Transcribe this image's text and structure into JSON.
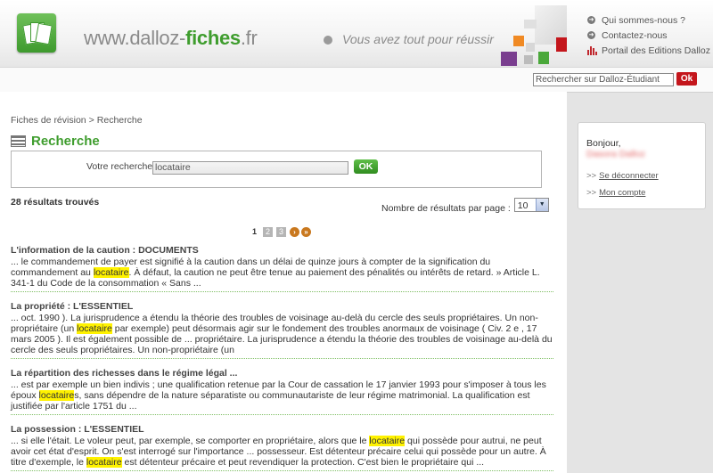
{
  "header": {
    "site_name_prefix": "www.dalloz-",
    "site_name_bold": "fiches",
    "site_name_suffix": ".fr",
    "tagline": "Vous avez tout pour réussir",
    "links": [
      {
        "label": "Qui sommes-nous ?",
        "icon": "circle-arrow-icon"
      },
      {
        "label": "Contactez-nous",
        "icon": "circle-arrow-icon"
      },
      {
        "label": "Portail des Editions Dalloz",
        "icon": "dalloz-bars-icon"
      }
    ]
  },
  "top_search": {
    "placeholder": "Rechercher sur Dalloz-Étudiant",
    "button_label": "Ok"
  },
  "breadcrumb": {
    "items": [
      "Fiches de révision",
      "Recherche"
    ],
    "separator": ">"
  },
  "page": {
    "title": "Recherche",
    "search_label": "Votre recherche",
    "search_value": "locataire",
    "search_button": "OK",
    "results_count": "28 résultats trouvés",
    "per_page_label": "Nombre de résultats par page :",
    "per_page_value": "10"
  },
  "pagination": {
    "current": "1",
    "pages": [
      "2",
      "3"
    ],
    "next_icon": "next-arrow-icon",
    "last_icon": "last-arrow-icon"
  },
  "results": [
    {
      "title": "L'information de la caution : DOCUMENTS",
      "before": "... le commandement de payer est signifié à la caution dans un délai de quinze jours à compter de la signification du commandement au ",
      "hl": "locataire",
      "after": ". À défaut, la caution ne peut être tenue au paiement des pénalités ou intérêts de retard. » Article L. 341-1 du Code de la consommation « Sans ..."
    },
    {
      "title": "La propriété : L'ESSENTIEL",
      "before": "... oct. 1990 ). La jurisprudence a étendu la théorie des troubles de voisinage au-delà du cercle des seuls propriétaires. Un non-propriétaire (un ",
      "hl": "locataire",
      "after": " par exemple) peut désormais agir sur le fondement des troubles anormaux de voisinage ( Civ. 2 e , 17 mars 2005 ). Il est également possible de ... propriétaire. La jurisprudence a étendu la théorie des troubles de voisinage au-delà du cercle des seuls propriétaires. Un non-propriétaire (un"
    },
    {
      "title": "La répartition des richesses dans le régime légal ...",
      "before": "... est par exemple un bien indivis ; une qualification retenue par la Cour de cassation le 17 janvier 1993 pour s'imposer à tous les époux ",
      "hl": "locataire",
      "after": "s, sans dépendre de la nature séparatiste ou communautariste de leur régime matrimonial. La qualification est justifiée par l'article 1751 du ..."
    },
    {
      "title": "La possession : L'ESSENTIEL",
      "before": "... si elle l'était. Le voleur peut, par exemple, se comporter en propriétaire, alors que le ",
      "hl": "locataire",
      "after": " qui possède pour autrui, ne peut avoir cet état d'esprit. On s'est interrogé sur l'importance ... possesseur. Est détenteur précaire celui qui possède pour un autre. À titre d'exemple, le ",
      "hl2": "locataire",
      "after2": " est détenteur précaire et peut revendiquer la protection. C'est bien le propriétaire qui ..."
    }
  ],
  "sidebar": {
    "greeting": "Bonjour,",
    "user_name": "Dasora Dalloz",
    "logout_label": "Se déconnecter",
    "account_label": "Mon compte",
    "chevron": ">>"
  },
  "colors": {
    "brand_green": "#3f9d2e",
    "accent_red": "#c4161c",
    "highlight": "#fff200"
  }
}
